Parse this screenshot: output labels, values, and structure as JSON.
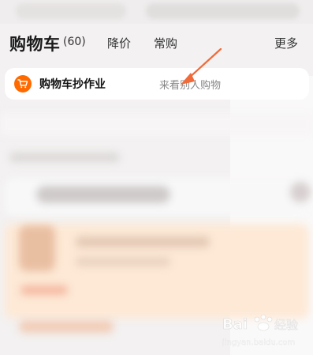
{
  "header": {
    "title": "购物车",
    "count": "(60)",
    "tabs": [
      {
        "label": "降价"
      },
      {
        "label": "常购"
      }
    ],
    "more_label": "更多"
  },
  "banner": {
    "title": "购物车抄作业",
    "link_text": "来看别人购物"
  },
  "colors": {
    "accent_orange": "#ff6a00",
    "annotation_arrow": "#f06a3a"
  },
  "icons": {
    "banner_icon": "shopping-cart-icon"
  }
}
